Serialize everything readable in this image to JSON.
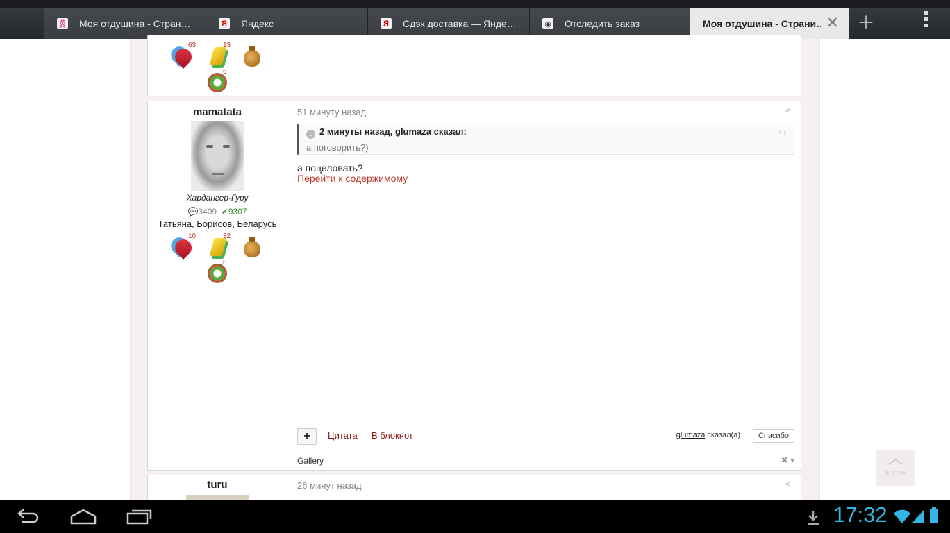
{
  "tabs": [
    {
      "title": "Моя отдушина - Стран…",
      "favicon": "ribbon-icon"
    },
    {
      "title": "Яндекс",
      "favicon": "Я"
    },
    {
      "title": "Сдэк доставка — Янде…",
      "favicon": "Я"
    },
    {
      "title": "Отследить заказ",
      "favicon": "globe-icon"
    },
    {
      "title": "Моя отдушина - Страни…",
      "favicon": "",
      "active": true
    }
  ],
  "prev_post": {
    "awards": [
      {
        "icon": "heart-icon",
        "count": "63"
      },
      {
        "icon": "gem-icon",
        "count": "13"
      },
      {
        "icon": "money-bag-icon",
        "count": ""
      },
      {
        "icon": "gear-icon",
        "count": "6"
      }
    ]
  },
  "post": {
    "username": "mamatata",
    "rank": "Хардангер-Гуру",
    "posts_count": "3409",
    "reputation": "9307",
    "location": "Татьяна, Борисов, Беларусь",
    "time": "51 минуту назад",
    "awards": [
      {
        "icon": "heart-icon",
        "count": "10"
      },
      {
        "icon": "gem-icon",
        "count": "32"
      },
      {
        "icon": "money-bag-icon",
        "count": ""
      },
      {
        "icon": "gear-icon",
        "count": "8"
      }
    ],
    "quote": {
      "header": "2 минуты назад, glumaza сказал:",
      "body": "а поговорить?)"
    },
    "text": "а поцеловать?",
    "link": "Перейти к содержимому",
    "actions": {
      "plus": "+",
      "quote": "Цитата",
      "notebook": "В блокнот"
    },
    "thanked_user": "glumaza",
    "thanked_suffix": "сказал(а)",
    "thanks_button": "Спасибо",
    "gallery": "Gallery"
  },
  "next_post": {
    "username": "turu",
    "time": "26 минут назад"
  },
  "scroll_top": {
    "label": "вверх"
  },
  "status": {
    "time": "17:32"
  },
  "colors": {
    "accent": "#33b5e5",
    "link": "#c0392b"
  }
}
